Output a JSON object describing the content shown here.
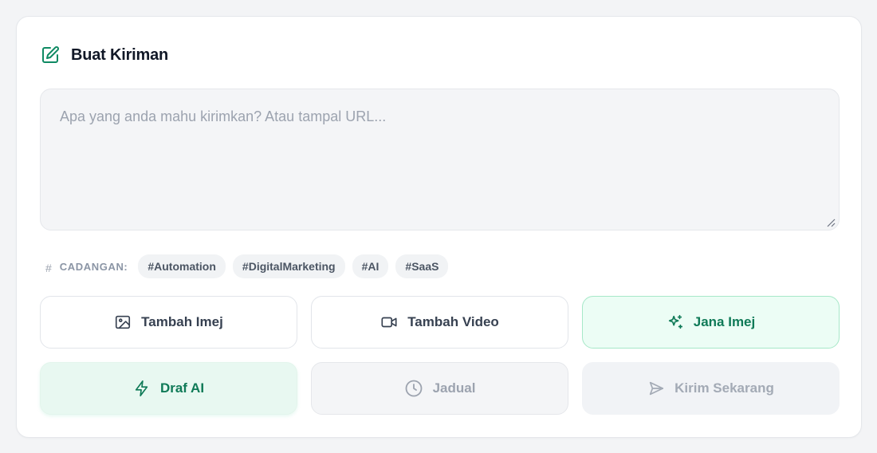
{
  "header": {
    "title": "Buat Kiriman",
    "icon": "edit-icon"
  },
  "composer": {
    "placeholder": "Apa yang anda mahu kirimkan? Atau tampal URL...",
    "value": ""
  },
  "suggestions": {
    "label": "CADANGAN:",
    "icon": "hash-icon",
    "tags": [
      "#Automation",
      "#DigitalMarketing",
      "#AI",
      "#SaaS"
    ]
  },
  "actions": {
    "add_image": "Tambah Imej",
    "add_video": "Tambah Video",
    "generate_image": "Jana Imej",
    "ai_draft": "Draf AI",
    "schedule": "Jadual",
    "send_now": "Kirim Sekarang"
  },
  "colors": {
    "accent": "#0f7a57",
    "accent_bg": "#ecfdf5",
    "disabled_text": "#9ca3af"
  }
}
